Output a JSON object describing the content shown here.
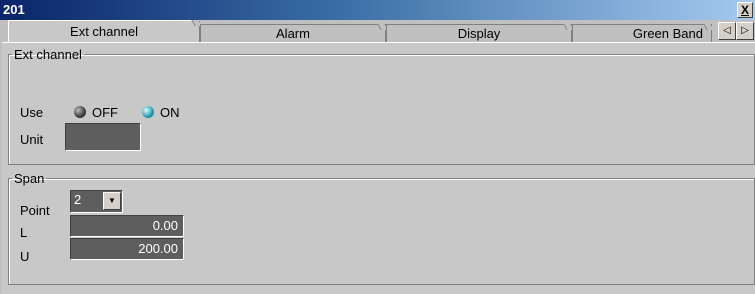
{
  "window": {
    "title": "201",
    "close_label": "X"
  },
  "tabs": [
    {
      "label": "Ext channel",
      "active": true
    },
    {
      "label": "Alarm",
      "active": false
    },
    {
      "label": "Display",
      "active": false
    },
    {
      "label": "Green Band",
      "active": false
    }
  ],
  "tab_arrows": {
    "left": "◁",
    "right": "▷"
  },
  "ext_channel": {
    "legend": "Ext channel",
    "use_label": "Use",
    "off_label": "OFF",
    "on_label": "ON",
    "selected": "ON",
    "unit_label": "Unit",
    "unit_value": ""
  },
  "span": {
    "legend": "Span",
    "point_label": "Point",
    "point_value": "2",
    "l_label": "L",
    "l_value": "0.00",
    "u_label": "U",
    "u_value": "200.00"
  },
  "colors": {
    "title_start": "#0a246a",
    "title_end": "#a6caf0",
    "field_bg": "#5e5e5e",
    "on_radio": "#1a8fa8"
  }
}
